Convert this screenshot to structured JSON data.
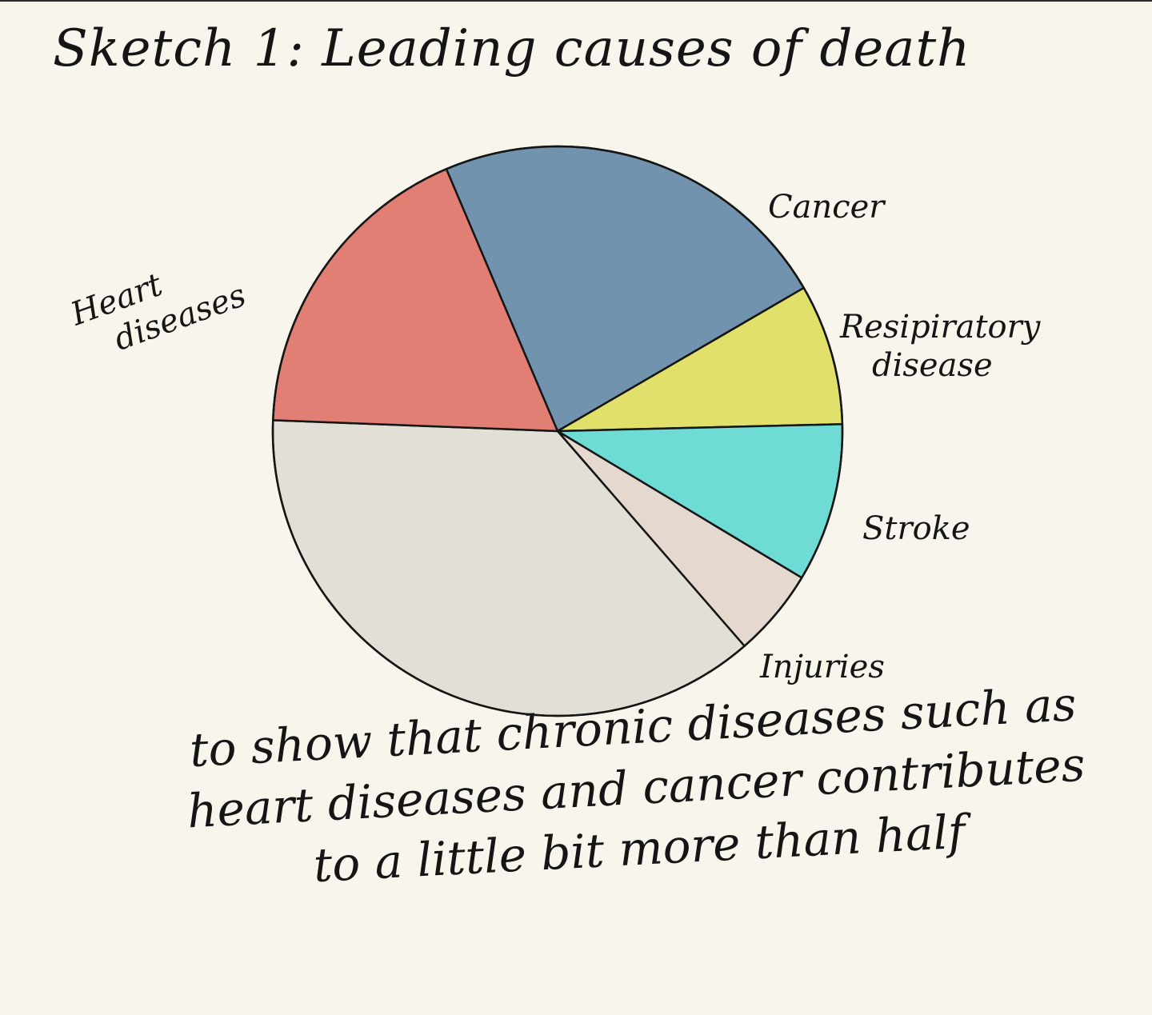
{
  "chart_data": {
    "type": "pie",
    "title": "Sketch 1: Leading causes of death",
    "series": [
      {
        "slices": [
          {
            "label": "Cancer",
            "value": 23,
            "color": "#7193ad"
          },
          {
            "label": "Resipiratory disease",
            "value": 8,
            "color": "#e0e06a"
          },
          {
            "label": "Stroke",
            "value": 9,
            "color": "#6edcd4"
          },
          {
            "label": "Injuries",
            "value": 5,
            "color": "#e4d8cf"
          },
          {
            "label": "",
            "value": 37,
            "color": "#e1dfd6"
          },
          {
            "label": "Heart diseases",
            "value": 18,
            "color": "#e27f74"
          }
        ]
      }
    ]
  },
  "caption": "to show that chronic diseases such as heart diseases and cancer contributes to a little bit more than half",
  "colors": {
    "background": "#f8f6ec",
    "ink": "#151515"
  }
}
